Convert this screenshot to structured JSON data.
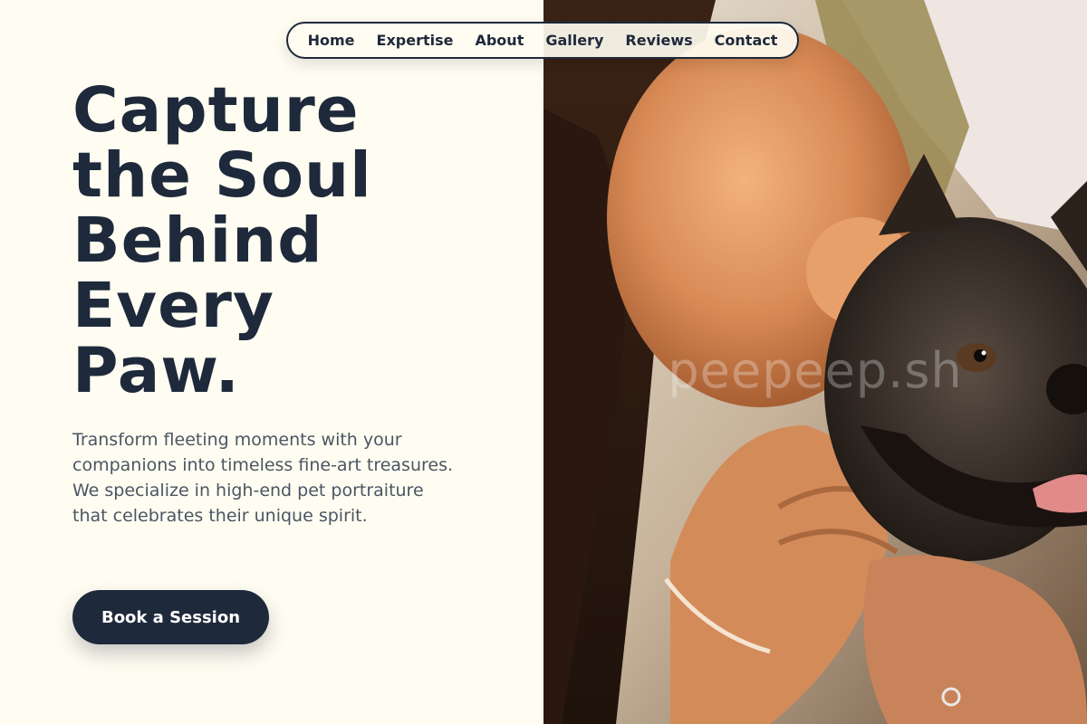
{
  "nav": {
    "items": [
      {
        "label": "Home"
      },
      {
        "label": "Expertise"
      },
      {
        "label": "About"
      },
      {
        "label": "Gallery"
      },
      {
        "label": "Reviews"
      },
      {
        "label": "Contact"
      }
    ]
  },
  "hero": {
    "title_lines": [
      "Capture",
      "the Soul",
      "Behind",
      "Every",
      "Paw."
    ],
    "description": "Transform fleeting moments with your companions into timeless fine-art treasures. We specialize in high-end pet portraiture that celebrates their unique spirit.",
    "cta_label": "Book a Session"
  },
  "photo": {
    "subject": "woman-kissing-dog",
    "watermark": "peepeep.sh"
  },
  "colors": {
    "background": "#fffdf1",
    "primary": "#1e293b",
    "text_muted": "#4b5563"
  }
}
